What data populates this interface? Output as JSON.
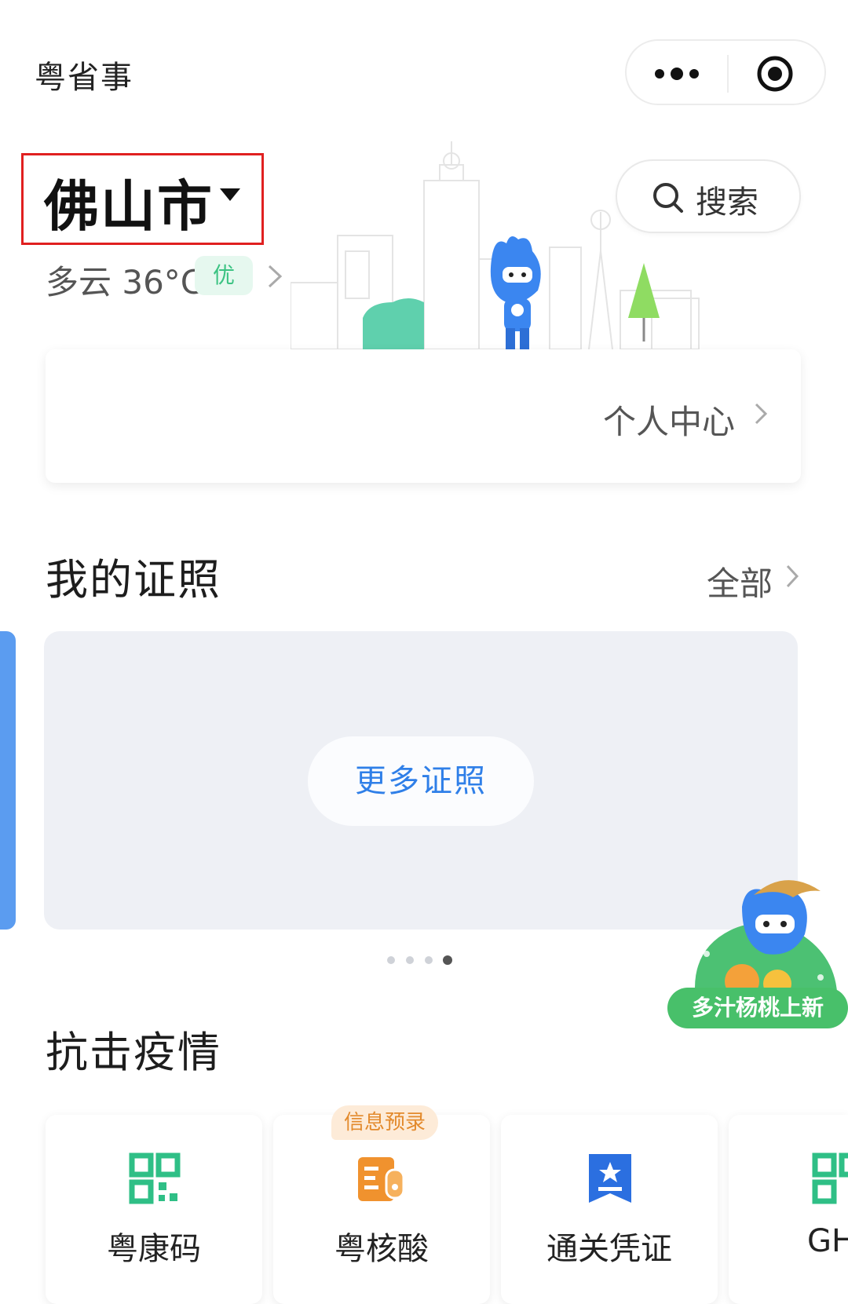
{
  "app": {
    "title": "粤省事"
  },
  "header": {
    "city": "佛山市",
    "weather": "多云 36°C",
    "air_quality": "优",
    "search_label": "搜索"
  },
  "profile": {
    "link_label": "个人中心"
  },
  "licenses": {
    "title": "我的证照",
    "all_label": "全部",
    "more_button": "更多证照",
    "page_count": 4,
    "active_page": 4
  },
  "promo": {
    "label": "多汁杨桃上新"
  },
  "epidemic": {
    "title": "抗击疫情",
    "services": [
      {
        "label": "粤康码",
        "icon": "qr-code-icon",
        "color": "#2fbf86"
      },
      {
        "label": "粤核酸",
        "icon": "test-tube-icon",
        "color": "#f0922e",
        "badge": "信息预录"
      },
      {
        "label": "通关凭证",
        "icon": "bookmark-star-icon",
        "color": "#2b6fe0"
      },
      {
        "label": "GH",
        "icon": "qr-code-icon",
        "color": "#2fbf86"
      }
    ]
  },
  "colors": {
    "highlight_box": "#e02020",
    "primary_blue": "#2f7fe8",
    "green": "#2fbf86"
  }
}
